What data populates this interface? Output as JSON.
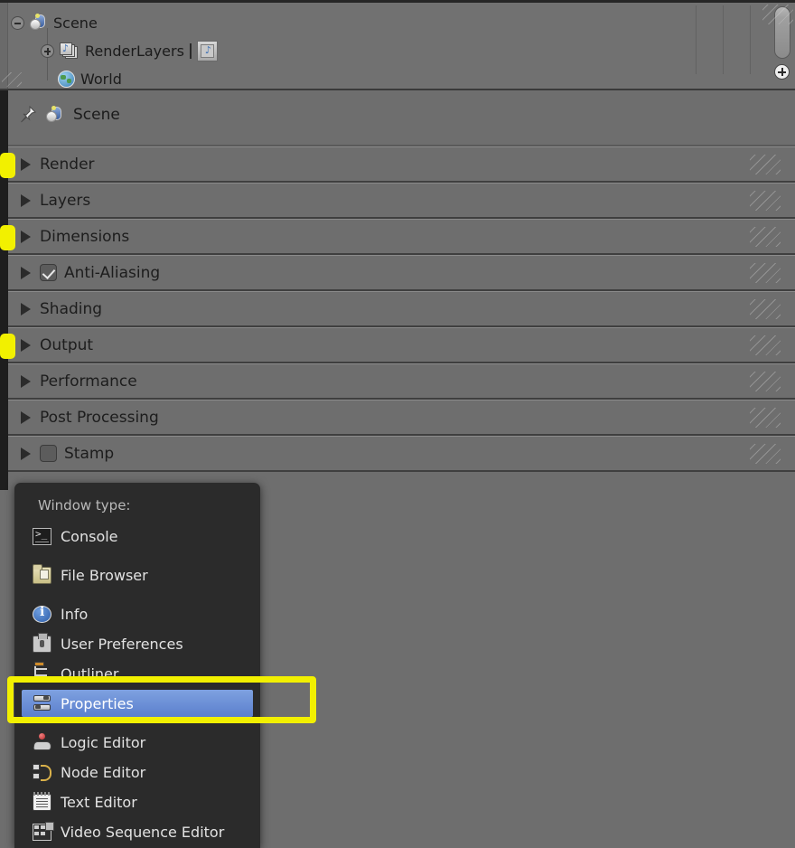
{
  "outliner": {
    "rows": [
      {
        "label": "Scene",
        "icon": "scene-icon",
        "toggle": "collapse-minus"
      },
      {
        "label": "RenderLayers",
        "icon": "render-layers-icon",
        "toggle": "expand-plus"
      },
      {
        "label": "World",
        "icon": "world-icon",
        "toggle": "none"
      }
    ],
    "add_button_icon": "plus-icon",
    "scrollbar_icon": "vertical-scrollbar"
  },
  "properties": {
    "header": {
      "pin_icon": "pin-icon",
      "datablock_icon": "scene-icon",
      "datablock_label": "Scene"
    },
    "panels": [
      {
        "label": "Render",
        "marked": true,
        "checkbox": null
      },
      {
        "label": "Layers",
        "marked": false,
        "checkbox": null
      },
      {
        "label": "Dimensions",
        "marked": true,
        "checkbox": null
      },
      {
        "label": "Anti-Aliasing",
        "marked": false,
        "checkbox": "checked"
      },
      {
        "label": "Shading",
        "marked": false,
        "checkbox": null
      },
      {
        "label": "Output",
        "marked": true,
        "checkbox": null
      },
      {
        "label": "Performance",
        "marked": false,
        "checkbox": null
      },
      {
        "label": "Post Processing",
        "marked": false,
        "checkbox": null
      },
      {
        "label": "Stamp",
        "marked": false,
        "checkbox": "unchecked"
      }
    ]
  },
  "window_type_menu": {
    "title": "Window type:",
    "items": [
      {
        "label": "Console",
        "icon": "console-icon",
        "selected": false
      },
      {
        "label": "File Browser",
        "icon": "folder-icon",
        "selected": false
      },
      {
        "label": "Info",
        "icon": "info-icon",
        "selected": false
      },
      {
        "label": "User Preferences",
        "icon": "preferences-icon",
        "selected": false
      },
      {
        "label": "Outliner",
        "icon": "outliner-icon",
        "selected": false
      },
      {
        "label": "Properties",
        "icon": "properties-icon",
        "selected": true
      },
      {
        "label": "Logic Editor",
        "icon": "logic-editor-icon",
        "selected": false
      },
      {
        "label": "Node Editor",
        "icon": "node-editor-icon",
        "selected": false
      },
      {
        "label": "Text Editor",
        "icon": "text-editor-icon",
        "selected": false
      },
      {
        "label": "Video Sequence Editor",
        "icon": "vse-icon",
        "selected": false
      }
    ]
  },
  "annotation": {
    "highlight_color": "#f2f000",
    "selection_color": "#5b7fcd",
    "target": "Properties"
  }
}
